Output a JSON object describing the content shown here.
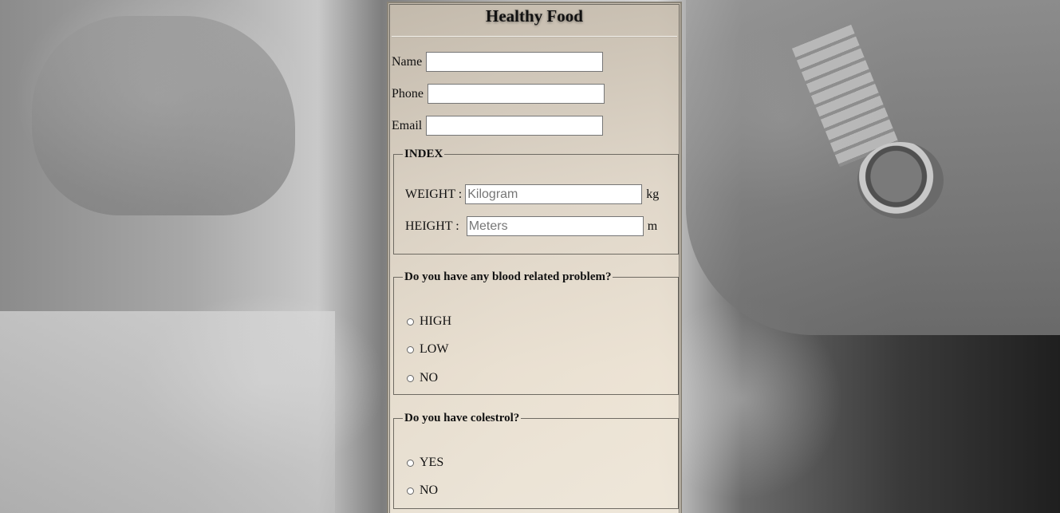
{
  "title": "Healthy Food",
  "fields": {
    "name_label": "Name",
    "name_value": "",
    "phone_label": "Phone",
    "phone_value": "",
    "email_label": "Email",
    "email_value": ""
  },
  "index": {
    "legend": "INDEX",
    "weight_label": "WEIGHT :",
    "weight_placeholder": "Kilogram",
    "weight_unit": "kg",
    "height_label": "HEIGHT :",
    "height_placeholder": "Meters",
    "height_unit": "m"
  },
  "blood": {
    "legend": "Do you have any blood related problem?",
    "options": [
      "HIGH",
      "LOW",
      "NO"
    ]
  },
  "colestrol": {
    "legend": "Do you have colestrol?",
    "options": [
      "YES",
      "NO"
    ]
  }
}
